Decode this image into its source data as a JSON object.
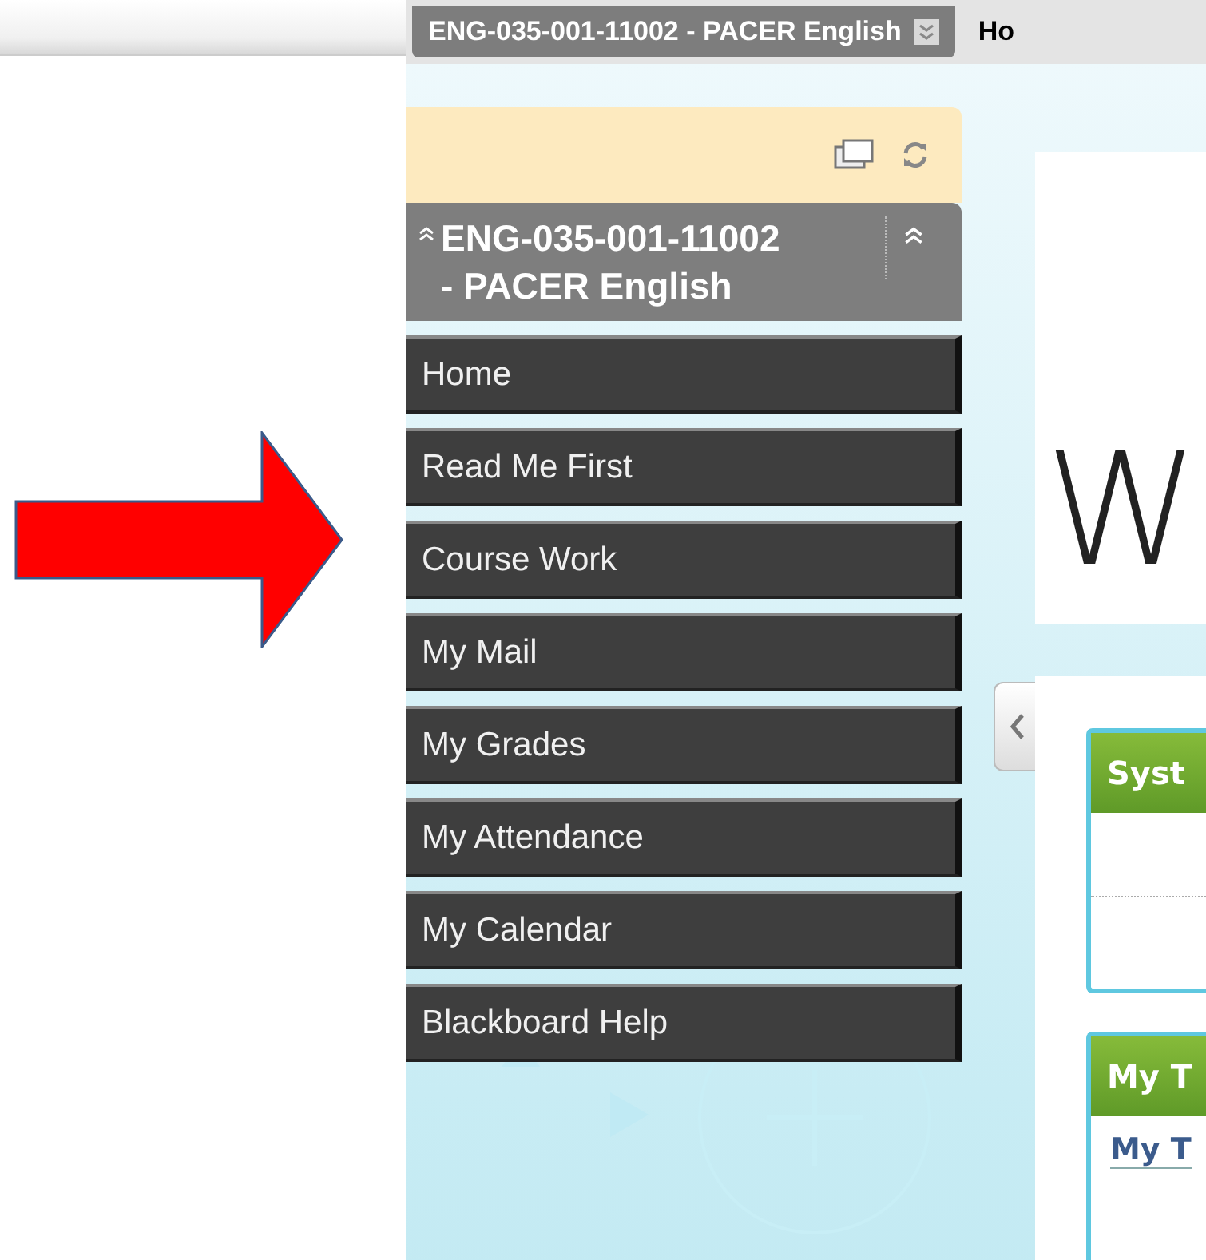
{
  "course_bar": {
    "course_button": "ENG-035-001-11002 - PACER English",
    "next_tab": "Ho"
  },
  "course_menu": {
    "title": "ENG-035-001-11002 - PACER English",
    "items": [
      {
        "label": "Home"
      },
      {
        "label": "Read Me First"
      },
      {
        "label": "Course Work"
      },
      {
        "label": "My Mail"
      },
      {
        "label": "My Grades"
      },
      {
        "label": "My Attendance"
      },
      {
        "label": "My Calendar"
      },
      {
        "label": "Blackboard Help"
      }
    ]
  },
  "banner": {
    "text": "W"
  },
  "modules": [
    {
      "title": "Syst"
    },
    {
      "title": "My T",
      "link": "My T"
    }
  ]
}
